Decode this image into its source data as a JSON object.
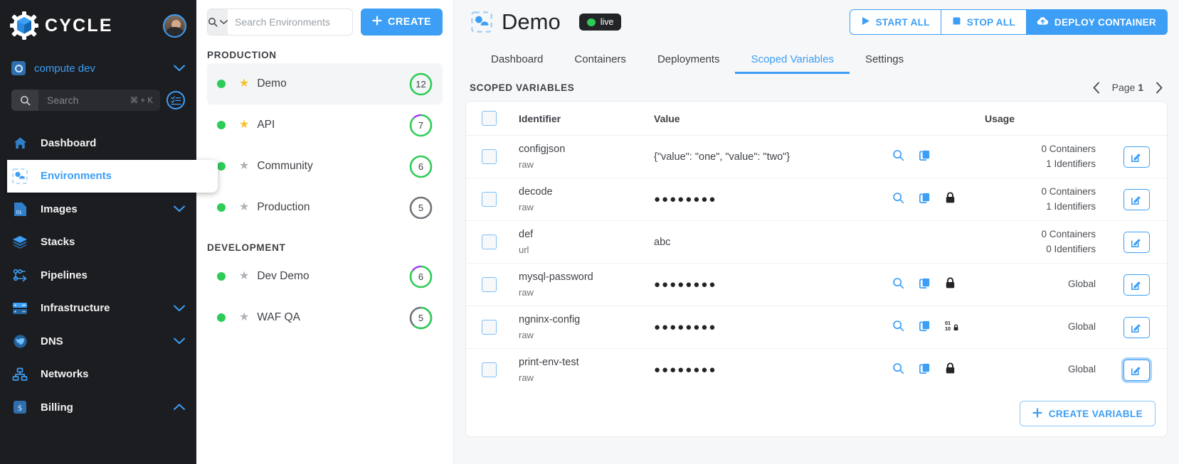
{
  "brand": {
    "name": "CYCLE",
    "logo_icon": "cycle-cube-gear-logo",
    "avatar_icon": "user-avatar"
  },
  "sidebar": {
    "hub": {
      "label": "compute dev",
      "icon": "hub-icon",
      "chevron": "chevron-down-icon"
    },
    "search": {
      "placeholder": "Search",
      "shortcut": "⌘ + K",
      "icon": "search-icon",
      "list_icon": "list-view-icon"
    },
    "items": [
      {
        "label": "Dashboard",
        "icon": "home-icon",
        "active": false,
        "expandable": false
      },
      {
        "label": "Environments",
        "icon": "environments-icon",
        "active": true,
        "expandable": false
      },
      {
        "label": "Images",
        "icon": "image-file-icon",
        "active": false,
        "expandable": true,
        "chevron": "chevron-down-icon"
      },
      {
        "label": "Stacks",
        "icon": "layers-icon",
        "active": false,
        "expandable": false
      },
      {
        "label": "Pipelines",
        "icon": "pipelines-icon",
        "active": false,
        "expandable": false
      },
      {
        "label": "Infrastructure",
        "icon": "server-icon",
        "active": false,
        "expandable": true,
        "chevron": "chevron-down-icon"
      },
      {
        "label": "DNS",
        "icon": "globe-icon",
        "active": false,
        "expandable": true,
        "chevron": "chevron-down-icon"
      },
      {
        "label": "Networks",
        "icon": "network-icon",
        "active": false,
        "expandable": false
      },
      {
        "label": "Billing",
        "icon": "dollar-icon",
        "active": false,
        "expandable": true,
        "chevron": "chevron-up-icon"
      }
    ]
  },
  "envpanel": {
    "search": {
      "placeholder": "Search Environments",
      "icon": "search-icon",
      "chevron": "chevron-down-icon"
    },
    "create_label": "CREATE",
    "groups": [
      {
        "title": "PRODUCTION",
        "environments": [
          {
            "name": "Demo",
            "state": "online",
            "starred": true,
            "count": "12",
            "ring": "green-full",
            "selected": true
          },
          {
            "name": "API",
            "state": "online",
            "starred": true,
            "count": "7",
            "ring": "green-purple",
            "selected": false
          },
          {
            "name": "Community",
            "state": "online",
            "starred": false,
            "count": "6",
            "ring": "green-full",
            "selected": false
          },
          {
            "name": "Production",
            "state": "online",
            "starred": false,
            "count": "5",
            "ring": "grey",
            "selected": false
          }
        ]
      },
      {
        "title": "DEVELOPMENT",
        "environments": [
          {
            "name": "Dev Demo",
            "state": "online",
            "starred": false,
            "count": "6",
            "ring": "green-purple",
            "selected": false
          },
          {
            "name": "WAF QA",
            "state": "online",
            "starred": false,
            "count": "5",
            "ring": "green-grey",
            "selected": false
          }
        ]
      }
    ]
  },
  "main": {
    "title": "Demo",
    "title_icon": "environment-icon",
    "status_badge": "live",
    "actions": [
      {
        "label": "START ALL",
        "icon": "play-icon",
        "style": "outline"
      },
      {
        "label": "STOP ALL",
        "icon": "stop-icon",
        "style": "outline"
      },
      {
        "label": "DEPLOY CONTAINER",
        "icon": "cloud-upload-icon",
        "style": "primary"
      }
    ],
    "tabs": [
      {
        "label": "Dashboard",
        "active": false
      },
      {
        "label": "Containers",
        "active": false
      },
      {
        "label": "Deployments",
        "active": false
      },
      {
        "label": "Scoped Variables",
        "active": true
      },
      {
        "label": "Settings",
        "active": false
      }
    ],
    "section_title": "SCOPED VARIABLES",
    "pager": {
      "prev_icon": "chevron-left-icon",
      "next_icon": "chevron-right-icon",
      "label": "Page",
      "page": "1"
    },
    "table": {
      "columns": [
        "",
        "Identifier",
        "Value",
        "",
        "Usage",
        ""
      ],
      "rows": [
        {
          "identifier": "configjson",
          "subtype": "raw",
          "value": "{\"value\": \"one\", \"value\": \"two\"}",
          "masked": false,
          "icons": [
            "search-icon",
            "copy-icon"
          ],
          "usage_lines": [
            "0 Containers",
            "1 Identifiers"
          ],
          "edit_icon": "edit-icon",
          "edit_focused": false
        },
        {
          "identifier": "decode",
          "subtype": "raw",
          "value": "●●●●●●●●",
          "masked": true,
          "icons": [
            "search-icon",
            "copy-icon",
            "lock-icon"
          ],
          "usage_lines": [
            "0 Containers",
            "1 Identifiers"
          ],
          "edit_icon": "edit-icon",
          "edit_focused": false
        },
        {
          "identifier": "def",
          "subtype": "url",
          "value": "abc",
          "masked": false,
          "icons": [],
          "usage_lines": [
            "0 Containers",
            "0 Identifiers"
          ],
          "edit_icon": "edit-icon",
          "edit_focused": false
        },
        {
          "identifier": "mysql-password",
          "subtype": "raw",
          "value": "●●●●●●●●",
          "masked": true,
          "icons": [
            "search-icon",
            "copy-icon",
            "lock-icon"
          ],
          "usage_lines": [
            "Global"
          ],
          "edit_icon": "edit-icon",
          "edit_focused": false
        },
        {
          "identifier": "ngninx-config",
          "subtype": "raw",
          "value": "●●●●●●●●",
          "masked": true,
          "icons": [
            "search-icon",
            "copy-icon",
            "binary-lock-icon"
          ],
          "usage_lines": [
            "Global"
          ],
          "edit_icon": "edit-icon",
          "edit_focused": false
        },
        {
          "identifier": "print-env-test",
          "subtype": "raw",
          "value": "●●●●●●●●",
          "masked": true,
          "icons": [
            "search-icon",
            "copy-icon",
            "lock-icon"
          ],
          "usage_lines": [
            "Global"
          ],
          "edit_icon": "edit-icon",
          "edit_focused": true
        }
      ]
    },
    "create_variable_label": "CREATE VARIABLE"
  },
  "colors": {
    "accent": "#3c9ef5",
    "sidebar_bg": "#1c1d21",
    "online": "#2ecc57",
    "star_on": "#f7c12c",
    "ring_purple": "#9b3ff5",
    "ring_grey": "#6f7479"
  }
}
